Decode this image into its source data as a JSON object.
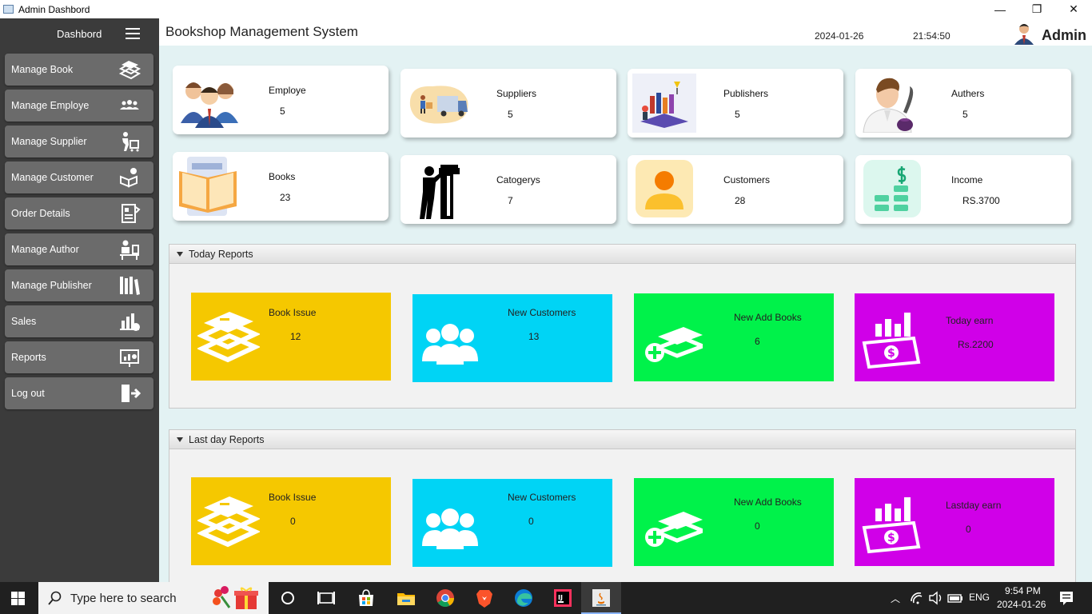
{
  "window": {
    "title": "Admin Dashbord",
    "minimize": "—",
    "restore": "❐",
    "close": "✕"
  },
  "sidebar": {
    "title": "Dashbord",
    "items": [
      {
        "label": "Manage Book"
      },
      {
        "label": "Manage Employe"
      },
      {
        "label": "Manage Supplier"
      },
      {
        "label": "Manage Customer"
      },
      {
        "label": "Order Details"
      },
      {
        "label": "Manage Author"
      },
      {
        "label": "Manage Publisher"
      },
      {
        "label": "Sales"
      },
      {
        "label": "Reports"
      },
      {
        "label": "Log out"
      }
    ]
  },
  "header": {
    "title": "Bookshop Management System",
    "date": "2024-01-26",
    "time": "21:54:50",
    "user": "Admin"
  },
  "stats": [
    {
      "label": "Employe",
      "value": "5"
    },
    {
      "label": "Suppliers",
      "value": "5"
    },
    {
      "label": "Publishers",
      "value": "5"
    },
    {
      "label": "Authers",
      "value": "5"
    },
    {
      "label": "Books",
      "value": "23"
    },
    {
      "label": "Catogerys",
      "value": "7"
    },
    {
      "label": "Customers",
      "value": "28"
    },
    {
      "label": "Income",
      "value": "RS.3700"
    }
  ],
  "today": {
    "title": "Today Reports",
    "cards": [
      {
        "label": "Book Issue",
        "value": "12",
        "color": "#f5c800"
      },
      {
        "label": "New Customers",
        "value": "13",
        "color": "#00d4f5"
      },
      {
        "label": "New Add Books",
        "value": "6",
        "color": "#00f24a"
      },
      {
        "label": "Today earn",
        "value": "Rs.2200",
        "color": "#d000e8"
      }
    ]
  },
  "lastday": {
    "title": "Last day Reports",
    "cards": [
      {
        "label": "Book Issue",
        "value": "0",
        "color": "#f5c800"
      },
      {
        "label": "New Customers",
        "value": "0",
        "color": "#00d4f5"
      },
      {
        "label": "New Add Books",
        "value": "0",
        "color": "#00f24a"
      },
      {
        "label": "Lastday earn",
        "value": "0",
        "color": "#d000e8"
      }
    ]
  },
  "taskbar": {
    "search_placeholder": "Type here to search",
    "lang": "ENG",
    "time": "9:54 PM",
    "date": "2024-01-26"
  }
}
